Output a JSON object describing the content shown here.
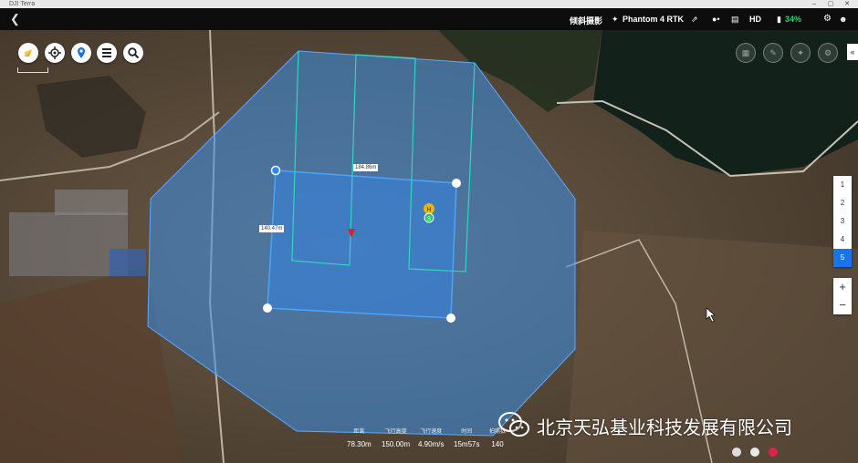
{
  "window": {
    "title": "DJI Terra",
    "controls": [
      "–",
      "▢",
      "✕"
    ]
  },
  "topbar": {
    "back_icon": "chevron-left-icon",
    "mission_name": "倾斜摄影",
    "drone_model": "Phantom 4 RTK",
    "signal_label": "HD",
    "battery": "34%"
  },
  "map_tools": [
    "compass-icon",
    "locate-icon",
    "pin-icon",
    "list-icon",
    "search-icon"
  ],
  "map": {
    "dimension_top": "184.86m",
    "dimension_left": "140.47m",
    "home_marker": "H",
    "start_marker": "S"
  },
  "route_steps": [
    "1",
    "2",
    "3",
    "4",
    "5"
  ],
  "active_step": "5",
  "zoom": {
    "in": "+",
    "out": "−"
  },
  "collapse_label": "«",
  "stats": [
    {
      "label": "距离",
      "value": "78.30m"
    },
    {
      "label": "飞行高度",
      "value": "150.00m"
    },
    {
      "label": "飞行速度",
      "value": "4.90m/s"
    },
    {
      "label": "时间",
      "value": "15m57s"
    },
    {
      "label": "拍照数",
      "value": "140"
    }
  ],
  "watermark": "北京天弘基业科技发展有限公司",
  "colors": {
    "area_fill": "#3a8fe8",
    "route": "#2fd6c0",
    "accent": "#1a73e8",
    "battery": "#35d06e"
  }
}
